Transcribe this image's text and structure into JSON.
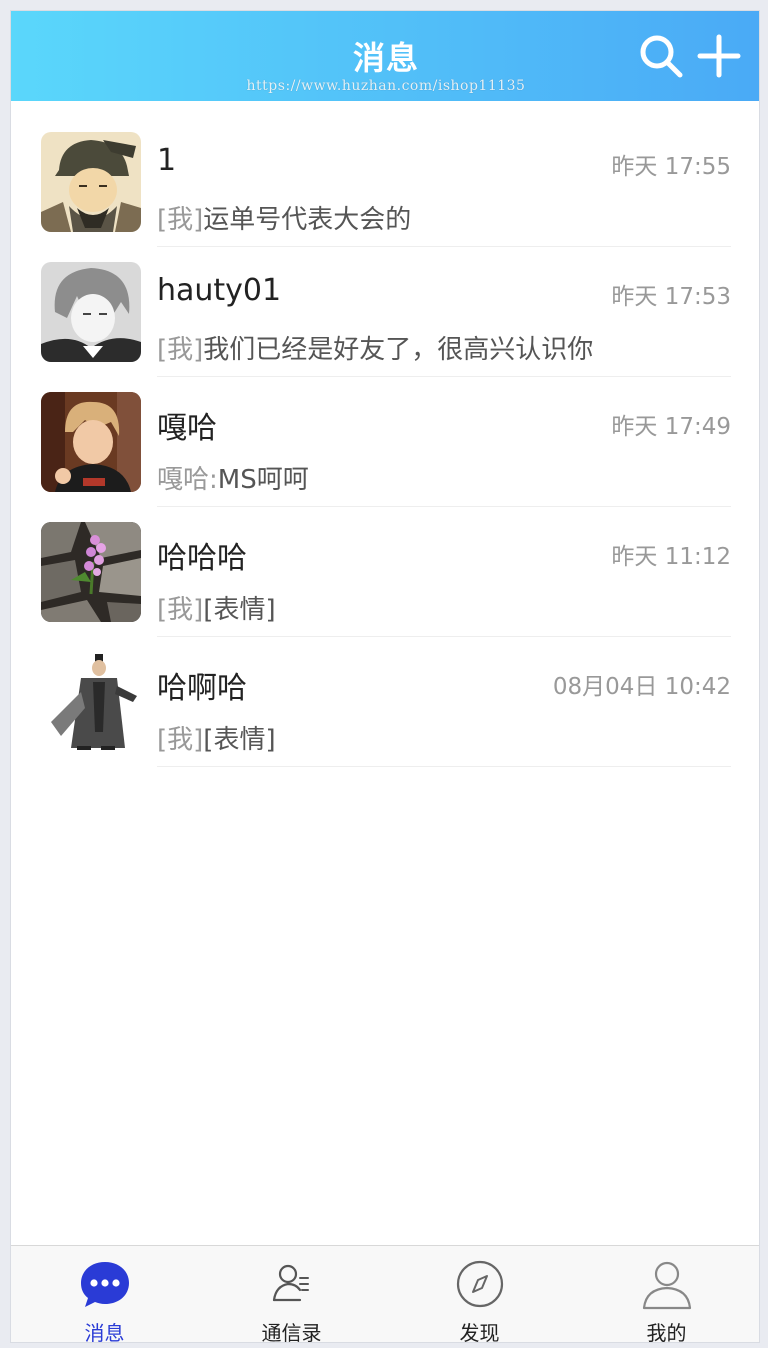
{
  "header": {
    "title": "消息",
    "watermark": "https://www.huzhan.com/ishop11135",
    "search_icon": "search-icon",
    "add_icon": "plus-icon"
  },
  "conversations": [
    {
      "name": "1",
      "time": "昨天 17:55",
      "prefix": "[我]",
      "message": "运单号代表大会的",
      "avatar": "scholar-portrait"
    },
    {
      "name": "hauty01",
      "time": "昨天 17:53",
      "prefix": "[我]",
      "message": "我们已经是好友了，很高兴认识你",
      "avatar": "anime-sketch-portrait"
    },
    {
      "name": "嘎哈",
      "time": "昨天 17:49",
      "prefix": "嘎哈:",
      "message": "MS呵呵",
      "avatar": "young-man-photo"
    },
    {
      "name": "哈哈哈",
      "time": "昨天 11:12",
      "prefix": "[我]",
      "message": "[表情]",
      "avatar": "flower-on-rocks"
    },
    {
      "name": "哈啊哈",
      "time": "08月04日 10:42",
      "prefix": "[我]",
      "message": "[表情]",
      "avatar": "ancient-warrior"
    }
  ],
  "tabbar": {
    "tabs": [
      {
        "label": "消息",
        "icon": "chat-bubble-icon",
        "active": true
      },
      {
        "label": "通信录",
        "icon": "contacts-icon",
        "active": false
      },
      {
        "label": "发现",
        "icon": "compass-icon",
        "active": false
      },
      {
        "label": "我的",
        "icon": "person-icon",
        "active": false
      }
    ]
  },
  "colors": {
    "header_start": "#5ad7fb",
    "header_end": "#4aaaf6",
    "active_tab": "#2a3bd6",
    "time_text": "#999999"
  }
}
